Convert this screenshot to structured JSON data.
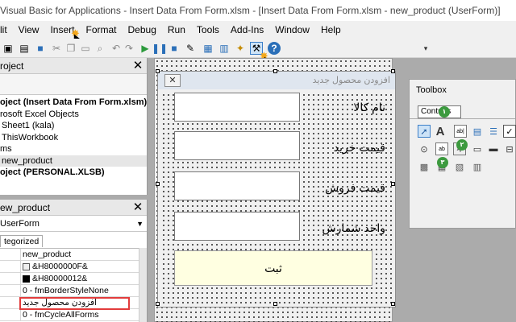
{
  "window": {
    "title": "Visual Basic for Applications - Insert Data From Form.xlsm - [Insert Data From Form.xlsm - new_product (UserForm)]"
  },
  "menu": [
    "lit",
    "View",
    "Insert",
    "Format",
    "Debug",
    "Run",
    "Tools",
    "Add-Ins",
    "Window",
    "Help"
  ],
  "project_panel": {
    "header": "roject",
    "items": [
      {
        "text": "oject (Insert Data From Form.xlsm)",
        "bold": true
      },
      {
        "text": "rosoft Excel Objects",
        "bold": false
      },
      {
        "text": "Sheet1 (kala)",
        "bold": false
      },
      {
        "text": "ThisWorkbook",
        "bold": false
      },
      {
        "text": "ms",
        "bold": false
      },
      {
        "text": "new_product",
        "bold": false
      },
      {
        "text": "oject (PERSONAL.XLSB)",
        "bold": true
      }
    ]
  },
  "properties_panel": {
    "header": "ew_product",
    "object_select": "UserForm",
    "tab": "tegorized",
    "rows": [
      "new_product",
      "&H8000000F&",
      "&H80000012&",
      "0 - fmBorderStyleNone",
      "افزودن محصول جدید",
      "0 - fmCycleAllForms"
    ]
  },
  "userform": {
    "caption": "افزودن محصول جدید",
    "fields": [
      {
        "label": "نام کالا"
      },
      {
        "label": "قیمت خرید"
      },
      {
        "label": "قیمت فروش"
      },
      {
        "label": "واحد شمارش"
      }
    ],
    "submit_label": "ثبت"
  },
  "toolbox": {
    "title": "Toolbox",
    "tab": "Controls",
    "badges": [
      "۱",
      "۲",
      "۳"
    ]
  },
  "colors": {
    "highlight_border": "#e23c3c",
    "submit_bg": "#ffffe1",
    "marker": "#3c9a3f"
  }
}
